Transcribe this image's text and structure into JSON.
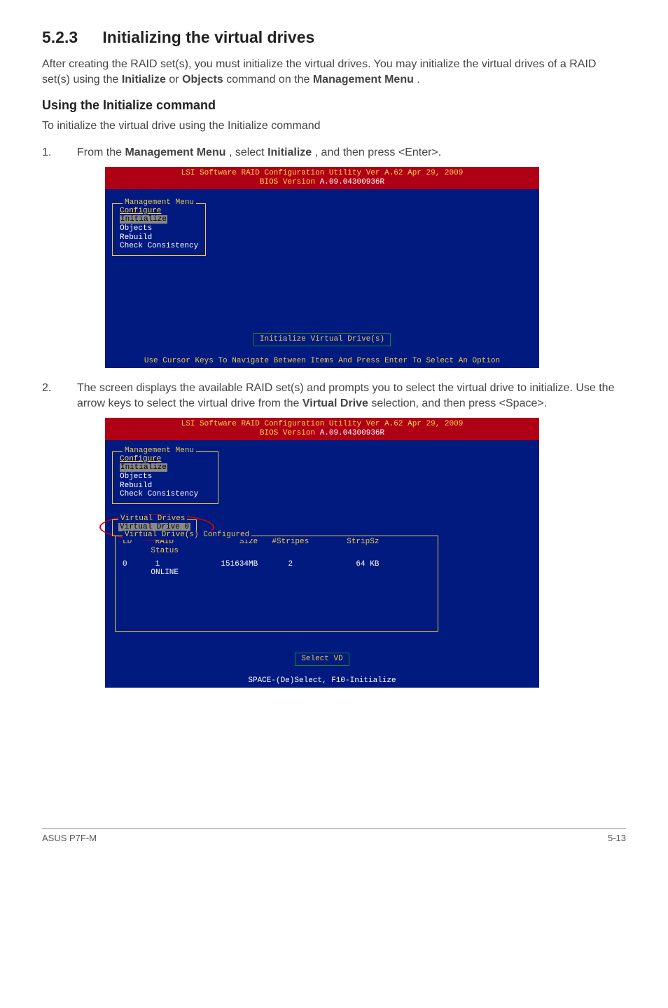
{
  "heading": {
    "number": "5.2.3",
    "title": "Initializing the virtual drives"
  },
  "intro": {
    "p1a": "After creating the RAID set(s), you must initialize the virtual drives. You may initialize the virtual drives of a RAID set(s) using the ",
    "b1": "Initialize",
    "p1b": " or ",
    "b2": "Objects",
    "p1c": " command on the ",
    "b3": "Management Menu",
    "p1d": "."
  },
  "sub1": "Using the Initialize command",
  "sub1_body": "To initialize the virtual drive using the Initialize command",
  "step1": {
    "n": "1.",
    "a": "From the ",
    "b1": "Management Menu",
    "b": ", select ",
    "b2": "Initialize",
    "c": ", and then press <Enter>."
  },
  "step2": {
    "n": "2.",
    "a": "The screen displays the available RAID set(s) and prompts you to select the virtual drive to initialize. Use the arrow keys to select the virtual drive from the ",
    "b1": "Virtual Drive",
    "b": " selection, and then press <Space>."
  },
  "bios1": {
    "title_line1": "LSI Software RAID Configuration Utility Ver A.62 Apr 29, 2009",
    "title_line2_label": "BIOS Version ",
    "title_line2_val": "A.09.04300936R",
    "menu_legend": "Management Menu",
    "items": [
      "Configure",
      "Initialize",
      "Objects",
      "Rebuild",
      "Check Consistency"
    ],
    "selected_index": 1,
    "hint": "Initialize Virtual Drive(s)",
    "footer": "Use Cursor Keys To Navigate Between Items And Press Enter To Select An Option"
  },
  "bios2": {
    "title_line1": "LSI Software RAID Configuration Utility Ver A.62 Apr 29, 2009",
    "title_line2_label": "BIOS Version ",
    "title_line2_val": "A.09.04300936R",
    "menu_legend": "Management Menu",
    "items": [
      "Configure",
      "Initialize",
      "Objects",
      "Rebuild",
      "Check Consistency"
    ],
    "selected_index": 1,
    "table_legend": "Virtual Drive(s) Configured",
    "cols": {
      "ld": "LD",
      "raid": "RAID",
      "size": "Size",
      "stripes": "#Stripes",
      "stripsz": "StripSz",
      "status": "Status"
    },
    "row": {
      "ld": "0",
      "raid": "1",
      "size": "151634MB",
      "stripes": "2",
      "stripsz": "64 KB",
      "status": "ONLINE"
    },
    "vd_legend": "Virtual Drives",
    "vd_item": "Virtual Drive 0",
    "hint": "Select VD",
    "footer": "SPACE-(De)Select,  F10-Initialize"
  },
  "pagefoot": {
    "left": "ASUS P7F-M",
    "right": "5-13"
  }
}
